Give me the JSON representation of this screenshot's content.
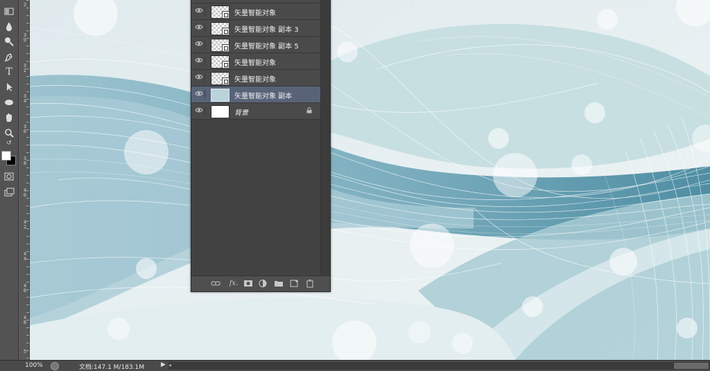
{
  "layers_panel": {
    "layers": [
      {
        "name": "矢量智能对象",
        "visible": true,
        "thumb": "smart-object",
        "selected": false
      },
      {
        "name": "矢量智能对象 副本 3",
        "visible": true,
        "thumb": "smart-object",
        "selected": false
      },
      {
        "name": "矢量智能对象 副本 5",
        "visible": true,
        "thumb": "smart-object",
        "selected": false
      },
      {
        "name": "矢量智能对象",
        "visible": true,
        "thumb": "smart-object",
        "selected": false
      },
      {
        "name": "矢量智能对象",
        "visible": true,
        "thumb": "smart-object",
        "selected": false
      },
      {
        "name": "矢量智能对象 副本",
        "visible": true,
        "thumb": "blue",
        "selected": true
      },
      {
        "name": "背景",
        "visible": true,
        "thumb": "white",
        "selected": false,
        "locked": true
      }
    ],
    "footer_icons": [
      "link-icon",
      "fx-icon",
      "mask-icon",
      "adjustment-icon",
      "folder-icon",
      "new-layer-icon",
      "trash-icon"
    ],
    "fx_label": "fx."
  },
  "toolbar": {
    "tools": [
      "gradient-icon",
      "blur-icon",
      "dodge-icon",
      "pen-icon",
      "type-icon",
      "path-select-icon",
      "ellipse-icon",
      "hand-icon",
      "zoom-icon",
      "swap-colors-icon",
      "color-swatches",
      "quick-mask-icon",
      "screen-mode-icon"
    ],
    "type_glyph": "T"
  },
  "ruler": {
    "marks": [
      "2",
      "3 0",
      "3 2",
      "3 4",
      "3 6",
      "3 8",
      "4 0",
      "4 2",
      "4 4",
      "4 6",
      "4 8",
      "5"
    ]
  },
  "status": {
    "zoom": "100%",
    "doc_info": "文档:147.1 M/183.1M",
    "arrow": "▶"
  },
  "colors": {
    "canvas_bg": "#e7eff1",
    "wave_dark": "#4f8ea4",
    "wave_light": "#a9cbd6",
    "selected_layer": "#596378"
  }
}
